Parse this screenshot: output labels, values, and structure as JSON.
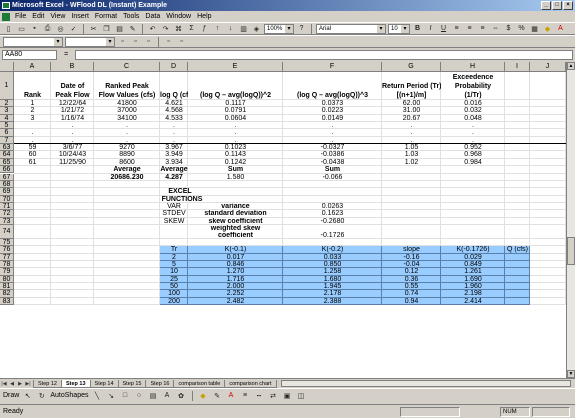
{
  "window": {
    "title": "Microsoft Excel - WFlood DL (Instant) Example"
  },
  "menu": [
    "File",
    "Edit",
    "View",
    "Insert",
    "Format",
    "Tools",
    "Data",
    "Window",
    "Help"
  ],
  "toolbar": {
    "zoom": "100%",
    "font": "Arial",
    "size": "10"
  },
  "formula_bar": {
    "name_box": "AA80",
    "fx": "="
  },
  "columns": [
    "A",
    "B",
    "C",
    "D",
    "E",
    "F",
    "G",
    "H",
    "I",
    "J"
  ],
  "headers": {
    "rank": "Rank",
    "date_a": "Date of",
    "date_b": "Peak Flow",
    "ranked_a": "Ranked Peak",
    "ranked_b": "Flow Values (cfs)",
    "logq": "log Q (cfs)",
    "sq": "(log Q – avg(logQ))^2",
    "cube": "(log Q – avg(logQ))^3",
    "rp_a": "Return Period (Tr)",
    "rp_b": "[(n+1)/m]",
    "ep_a": "Exceedence",
    "ep_b": "Probability",
    "ep_c": "(1/Tr)"
  },
  "data_rows": [
    {
      "row": "2",
      "a": "1",
      "b": "12/22/64",
      "c": "41800",
      "d": "4.621",
      "e": "0.1117",
      "f": "0.0373",
      "g": "62.00",
      "h": "0.016"
    },
    {
      "row": "3",
      "a": "2",
      "b": "1/21/72",
      "c": "37000",
      "d": "4.568",
      "e": "0.0791",
      "f": "0.0223",
      "g": "31.00",
      "h": "0.032"
    },
    {
      "row": "4",
      "a": "3",
      "b": "1/16/74",
      "c": "34100",
      "d": "4.533",
      "e": "0.0604",
      "f": "0.0149",
      "g": "20.67",
      "h": "0.048"
    },
    {
      "row": "5",
      "a": "",
      "b": ".",
      "c": ".",
      "d": ".",
      "e": ".",
      "f": ".",
      "g": ".",
      "h": "."
    },
    {
      "row": "6",
      "a": ".",
      "b": ".",
      "c": ".",
      "d": ".",
      "e": ".",
      "f": ".",
      "g": ".",
      "h": "."
    },
    {
      "row": "7",
      "a": ".",
      "b": ".",
      "c": ".",
      "d": ".",
      "e": ".",
      "f": ".",
      "g": ".",
      "h": "."
    },
    {
      "row": "63",
      "a": "59",
      "b": "3/6/77",
      "c": "9270",
      "d": "3.967",
      "e": "0.1023",
      "f": "-0.0327",
      "g": "1.05",
      "h": "0.952"
    },
    {
      "row": "64",
      "a": "60",
      "b": "10/24/43",
      "c": "8890",
      "d": "3.949",
      "e": "0.1143",
      "f": "-0.0386",
      "g": "1.03",
      "h": "0.968"
    },
    {
      "row": "65",
      "a": "61",
      "b": "11/25/90",
      "c": "8600",
      "d": "3.934",
      "e": "0.1242",
      "f": "-0.0438",
      "g": "1.02",
      "h": "0.984"
    }
  ],
  "summary": {
    "avg_label": "Average",
    "avg_flow": "20686.230",
    "avg_log_label": "Average",
    "avg_log": "4.287",
    "sum_label_e": "Sum",
    "sum_e": "1.580",
    "sum_label_f": "Sum",
    "sum_f": "-0.066"
  },
  "functions": {
    "title_a": "EXCEL",
    "title_b": "FUNCTIONS",
    "items": [
      {
        "fn": "VAR",
        "desc": "variance",
        "value": "0.0263"
      },
      {
        "fn": "STDEV",
        "desc": "standard deviation",
        "value": "0.1623"
      },
      {
        "fn": "SKEW",
        "desc": "skew coefficient",
        "value": "-0.2680"
      }
    ],
    "weighted_a": "weighted skew",
    "weighted_b": "coefficient",
    "weighted_value": "-0.1726"
  },
  "k_table": {
    "headers": [
      "Tr",
      "K(-0.1)",
      "K(-0.2)",
      "slope",
      "K(-0.1726)",
      "Q (cfs)"
    ],
    "rows": [
      {
        "row": "77",
        "tr": "2",
        "k1": "0.017",
        "k2": "0.033",
        "slope": "-0.16",
        "kw": "0.029"
      },
      {
        "row": "78",
        "tr": "5",
        "k1": "0.846",
        "k2": "0.850",
        "slope": "-0.04",
        "kw": "0.849"
      },
      {
        "row": "79",
        "tr": "10",
        "k1": "1.270",
        "k2": "1.258",
        "slope": "0.12",
        "kw": "1.261"
      },
      {
        "row": "80",
        "tr": "25",
        "k1": "1.716",
        "k2": "1.680",
        "slope": "0.36",
        "kw": "1.690"
      },
      {
        "row": "81",
        "tr": "50",
        "k1": "2.000",
        "k2": "1.945",
        "slope": "0.55",
        "kw": "1.960"
      },
      {
        "row": "82",
        "tr": "100",
        "k1": "2.252",
        "k2": "2.178",
        "slope": "0.74",
        "kw": "2.198"
      },
      {
        "row": "83",
        "tr": "200",
        "k1": "2.482",
        "k2": "2.388",
        "slope": "0.94",
        "kw": "2.414"
      }
    ]
  },
  "extra_rows": [
    "66",
    "67",
    "68",
    "69",
    "70",
    "71",
    "72",
    "73",
    "74",
    "75",
    "76"
  ],
  "sheet_tabs": [
    "Step 12",
    "Step 13",
    "Step 14",
    "Step 15",
    "Step 16",
    "comparison table",
    "comparison chart"
  ],
  "active_tab": "Step 13",
  "drawing": {
    "draw": "Draw",
    "autoshapes": "AutoShapes"
  },
  "status": {
    "left": "Ready",
    "num": "NUM"
  }
}
